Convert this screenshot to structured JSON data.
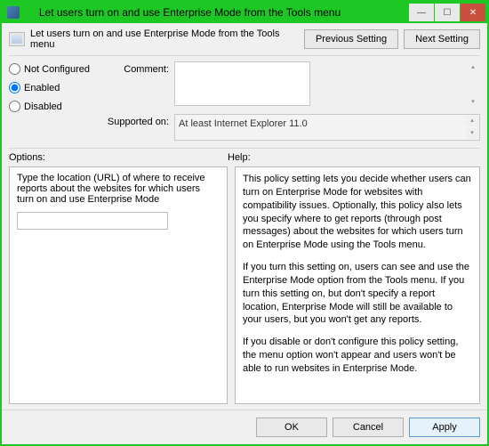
{
  "window": {
    "title": "Let users turn on and use Enterprise Mode from the Tools menu"
  },
  "header": {
    "label": "Let users turn on and use Enterprise Mode from the Tools menu"
  },
  "nav": {
    "previous": "Previous Setting",
    "next": "Next Setting"
  },
  "state": {
    "options": [
      {
        "id": "not_configured",
        "label": "Not Configured",
        "selected": false
      },
      {
        "id": "enabled",
        "label": "Enabled",
        "selected": true
      },
      {
        "id": "disabled",
        "label": "Disabled",
        "selected": false
      }
    ]
  },
  "fields": {
    "comment_label": "Comment:",
    "comment_value": "",
    "supported_label": "Supported on:",
    "supported_value": "At least Internet Explorer 11.0"
  },
  "panels": {
    "options_label": "Options:",
    "help_label": "Help:"
  },
  "options_panel": {
    "description": "Type the location (URL) of where to receive reports about the websites for which users turn on and use Enterprise Mode",
    "url_value": ""
  },
  "help_panel": {
    "p1": "This policy setting lets you decide whether users can turn on Enterprise Mode for websites with compatibility issues. Optionally, this policy also lets you specify where to get reports (through post messages) about the websites for which users turn on Enterprise Mode using the Tools menu.",
    "p2": "If you turn this setting on, users can see and use the Enterprise Mode option from the Tools menu. If you turn this setting on, but don't specify a report location, Enterprise Mode will still be available to your users, but you won't get any reports.",
    "p3": "If you disable or don't configure this policy setting, the menu option won't appear and users won't be able to run websites in Enterprise Mode."
  },
  "footer": {
    "ok": "OK",
    "cancel": "Cancel",
    "apply": "Apply"
  }
}
